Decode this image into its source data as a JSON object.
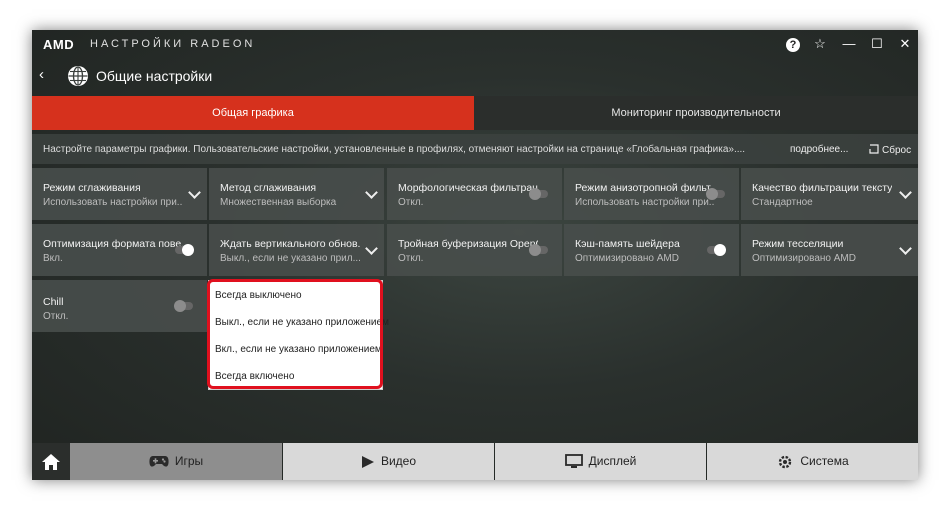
{
  "app": {
    "logo": "AMD",
    "title": "НАСТРОЙКИ RADEON",
    "controls": {
      "help": "?",
      "star": "☆",
      "minimize": "—",
      "maximize": "☐",
      "close": "✕"
    }
  },
  "nav": {
    "back": "‹",
    "title": "Общие настройки"
  },
  "tabs": [
    {
      "label": "Общая графика",
      "active": true
    },
    {
      "label": "Мониторинг производительности",
      "active": false
    }
  ],
  "info": {
    "text": "Настройте параметры графики. Пользовательские настройки, установленные в профилях, отменяют настройки на странице «Глобальная графика»....",
    "more": "подробнее...",
    "reset": "Сброс"
  },
  "tiles": [
    {
      "title": "Режим сглаживания",
      "value": "Использовать настройки при...",
      "control": "dropdown"
    },
    {
      "title": "Метод сглаживания",
      "value": "Множественная выборка",
      "control": "dropdown"
    },
    {
      "title": "Морфологическая фильтрация",
      "value": "Откл.",
      "control": "toggle-off"
    },
    {
      "title": "Режим анизотропной фильт...",
      "value": "Использовать настройки при...",
      "control": "toggle-off"
    },
    {
      "title": "Качество фильтрации текстур",
      "value": "Стандартное",
      "control": "dropdown"
    },
    {
      "title": "Оптимизация формата пове...",
      "value": "Вкл.",
      "control": "toggle-on"
    },
    {
      "title": "Ждать вертикального обнов...",
      "value": "Выкл., если не указано прил...",
      "control": "dropdown"
    },
    {
      "title": "Тройная буферизация OpenGL",
      "value": "Откл.",
      "control": "toggle-off"
    },
    {
      "title": "Кэш-память шейдера",
      "value": "Оптимизировано AMD",
      "control": "toggle-on"
    },
    {
      "title": "Режим тесселяции",
      "value": "Оптимизировано AMD",
      "control": "dropdown"
    },
    {
      "title": "Chill",
      "value": "Откл.",
      "control": "toggle-off"
    }
  ],
  "dropdown_options": [
    "Всегда выключено",
    "Выкл., если не указано приложением",
    "Вкл., если не указано приложением",
    "Всегда включено"
  ],
  "bottom_tabs": [
    {
      "label": "Игры",
      "icon": "gamepad-icon"
    },
    {
      "label": "Видео",
      "icon": "play-icon"
    },
    {
      "label": "Дисплей",
      "icon": "monitor-icon"
    },
    {
      "label": "Система",
      "icon": "system-gear-icon"
    }
  ],
  "colors": {
    "accent": "#d6311d",
    "highlight_frame": "#e0101e"
  }
}
